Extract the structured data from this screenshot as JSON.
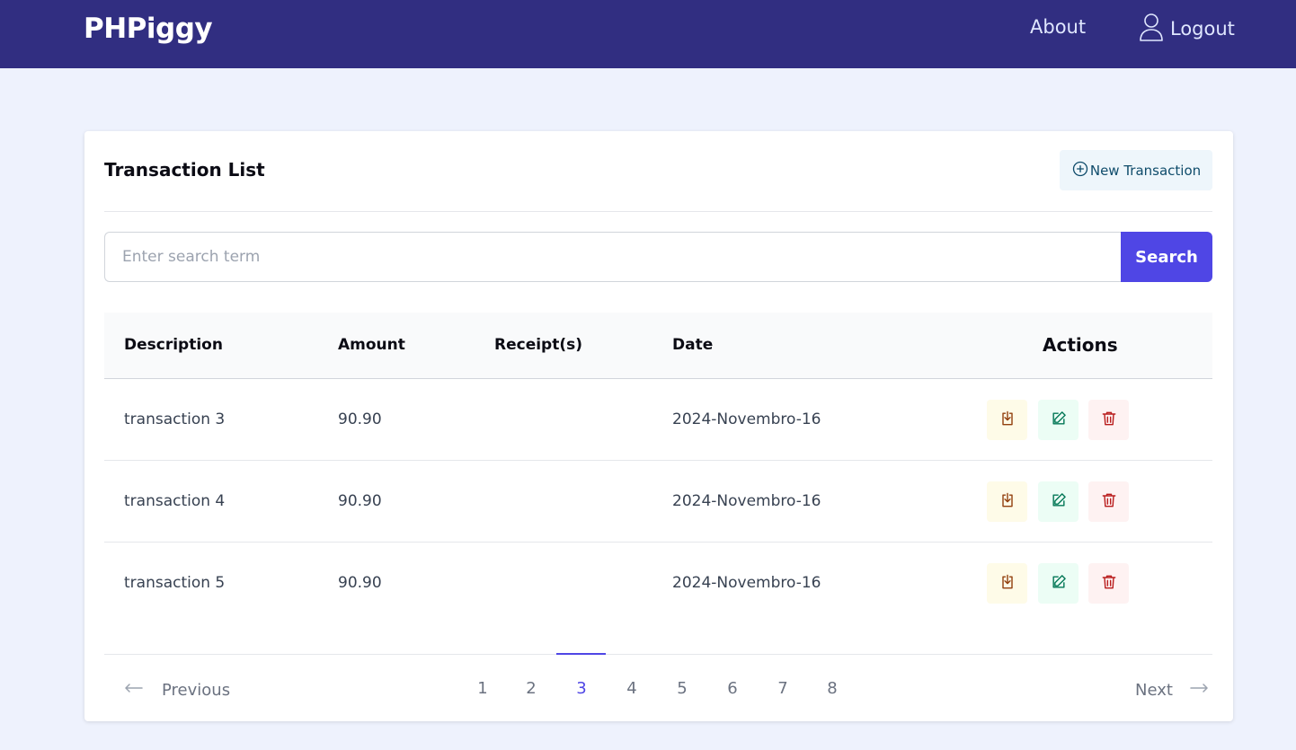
{
  "nav": {
    "brand": "PHPiggy",
    "about": "About",
    "logout": "Logout",
    "logout_icon": "user-icon"
  },
  "card": {
    "title": "Transaction List",
    "new_transaction": "New Transaction",
    "new_transaction_icon": "plus-circle-icon"
  },
  "search": {
    "placeholder": "Enter search term",
    "value": "",
    "button": "Search"
  },
  "table": {
    "headers": {
      "description": "Description",
      "amount": "Amount",
      "receipts": "Receipt(s)",
      "date": "Date",
      "actions": "Actions"
    },
    "rows": [
      {
        "description": "transaction 3",
        "amount": "90.90",
        "receipts": "",
        "date": "2024-Novembro-16"
      },
      {
        "description": "transaction 4",
        "amount": "90.90",
        "receipts": "",
        "date": "2024-Novembro-16"
      },
      {
        "description": "transaction 5",
        "amount": "90.90",
        "receipts": "",
        "date": "2024-Novembro-16"
      }
    ],
    "action_icons": [
      "download-icon",
      "edit-icon",
      "trash-icon"
    ]
  },
  "pagination": {
    "previous": "Previous",
    "next": "Next",
    "pages": [
      "1",
      "2",
      "3",
      "4",
      "5",
      "6",
      "7",
      "8"
    ],
    "current": "3"
  },
  "colors": {
    "navbar": "#312e81",
    "background": "#eef2fd",
    "accent": "#4f46e5",
    "download": "#92400e",
    "edit": "#047857",
    "delete": "#b91c1c"
  }
}
